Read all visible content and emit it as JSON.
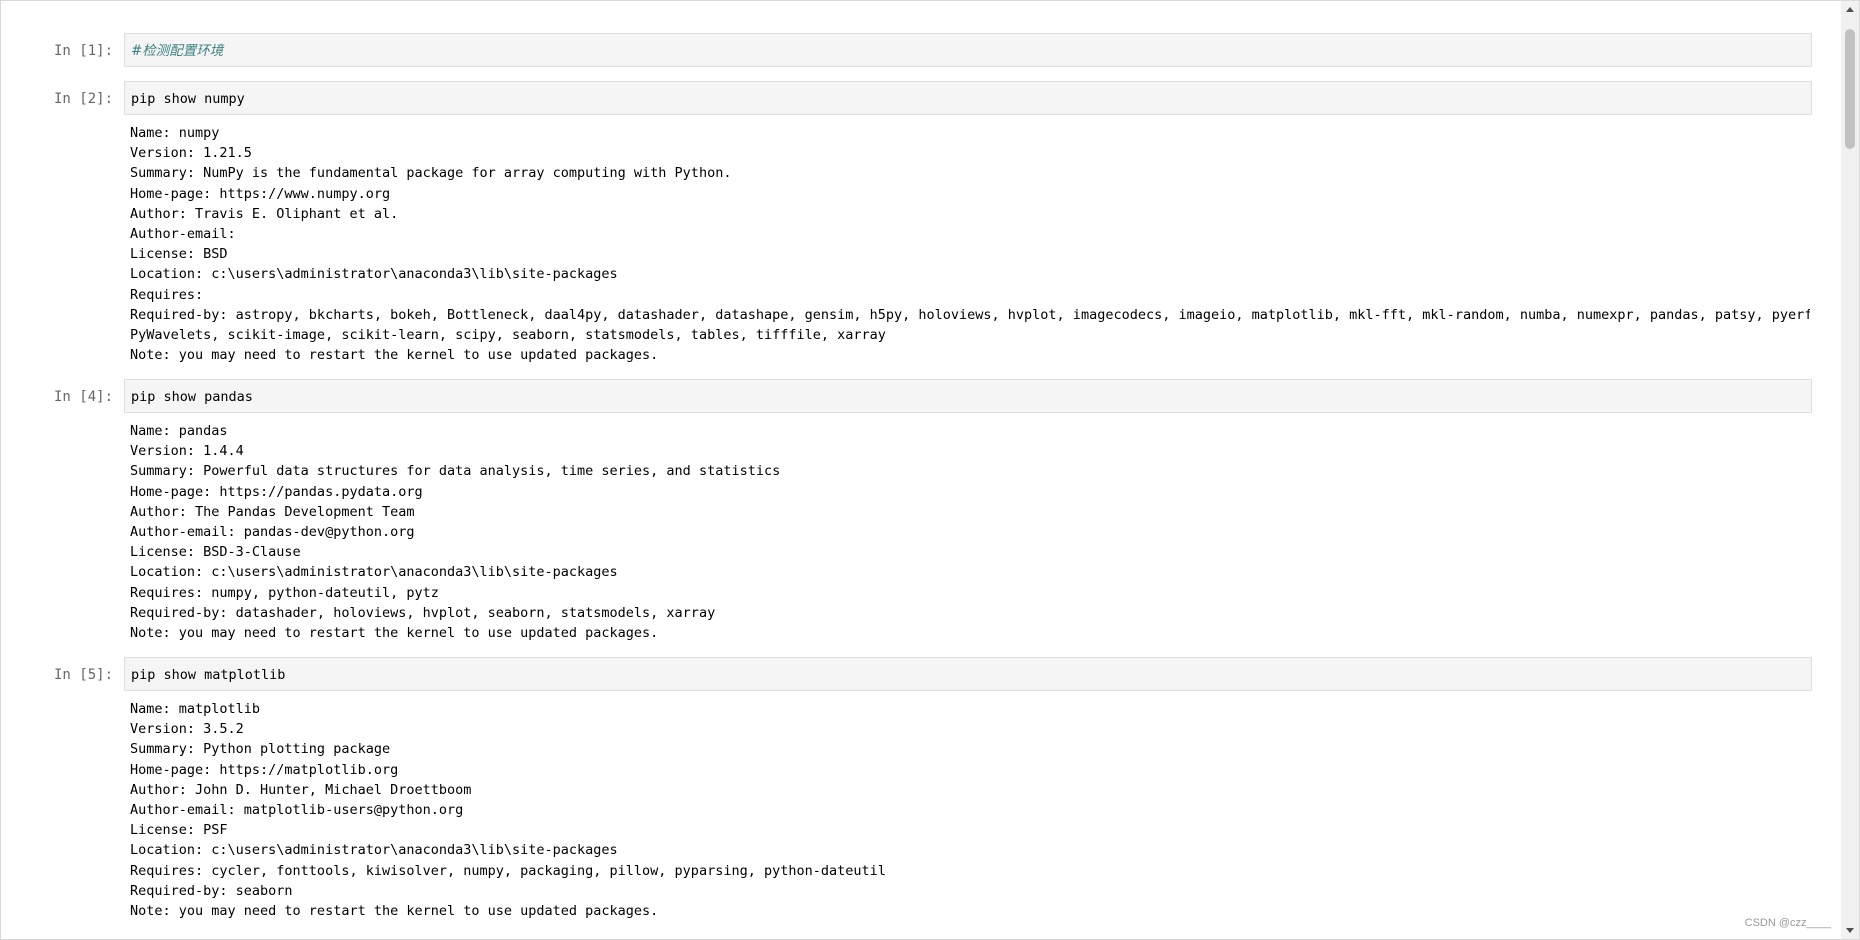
{
  "cells": [
    {
      "prompt": "In [1]:",
      "code": "#检测配置环境",
      "is_comment": true,
      "output": []
    },
    {
      "prompt": "In [2]:",
      "code": "pip show numpy",
      "is_comment": false,
      "output": [
        "Name: numpy",
        "Version: 1.21.5",
        "Summary: NumPy is the fundamental package for array computing with Python.",
        "Home-page: https://www.numpy.org",
        "Author: Travis E. Oliphant et al.",
        "Author-email:",
        "License: BSD",
        "Location: c:\\users\\administrator\\anaconda3\\lib\\site-packages",
        "Requires:",
        "Required-by: astropy, bkcharts, bokeh, Bottleneck, daal4py, datashader, datashape, gensim, h5py, holoviews, hvplot, imagecodecs, imageio, matplotlib, mkl-fft, mkl-random, numba, numexpr, pandas, patsy, pyerfa,",
        "PyWavelets, scikit-image, scikit-learn, scipy, seaborn, statsmodels, tables, tifffile, xarray",
        "Note: you may need to restart the kernel to use updated packages."
      ]
    },
    {
      "prompt": "In [4]:",
      "code": "pip show pandas",
      "is_comment": false,
      "output": [
        "Name: pandas",
        "Version: 1.4.4",
        "Summary: Powerful data structures for data analysis, time series, and statistics",
        "Home-page: https://pandas.pydata.org",
        "Author: The Pandas Development Team",
        "Author-email: pandas-dev@python.org",
        "License: BSD-3-Clause",
        "Location: c:\\users\\administrator\\anaconda3\\lib\\site-packages",
        "Requires: numpy, python-dateutil, pytz",
        "Required-by: datashader, holoviews, hvplot, seaborn, statsmodels, xarray",
        "Note: you may need to restart the kernel to use updated packages."
      ]
    },
    {
      "prompt": "In [5]:",
      "code": "pip show matplotlib",
      "is_comment": false,
      "output": [
        "Name: matplotlib",
        "Version: 3.5.2",
        "Summary: Python plotting package",
        "Home-page: https://matplotlib.org",
        "Author: John D. Hunter, Michael Droettboom",
        "Author-email: matplotlib-users@python.org",
        "License: PSF",
        "Location: c:\\users\\administrator\\anaconda3\\lib\\site-packages",
        "Requires: cycler, fonttools, kiwisolver, numpy, packaging, pillow, pyparsing, python-dateutil",
        "Required-by: seaborn",
        "Note: you may need to restart the kernel to use updated packages."
      ]
    }
  ],
  "watermark": "CSDN @czz____",
  "colors": {
    "input_bg": "#f5f5f5",
    "input_border": "#dddddd",
    "prompt": "#666666",
    "comment": "#408080"
  }
}
